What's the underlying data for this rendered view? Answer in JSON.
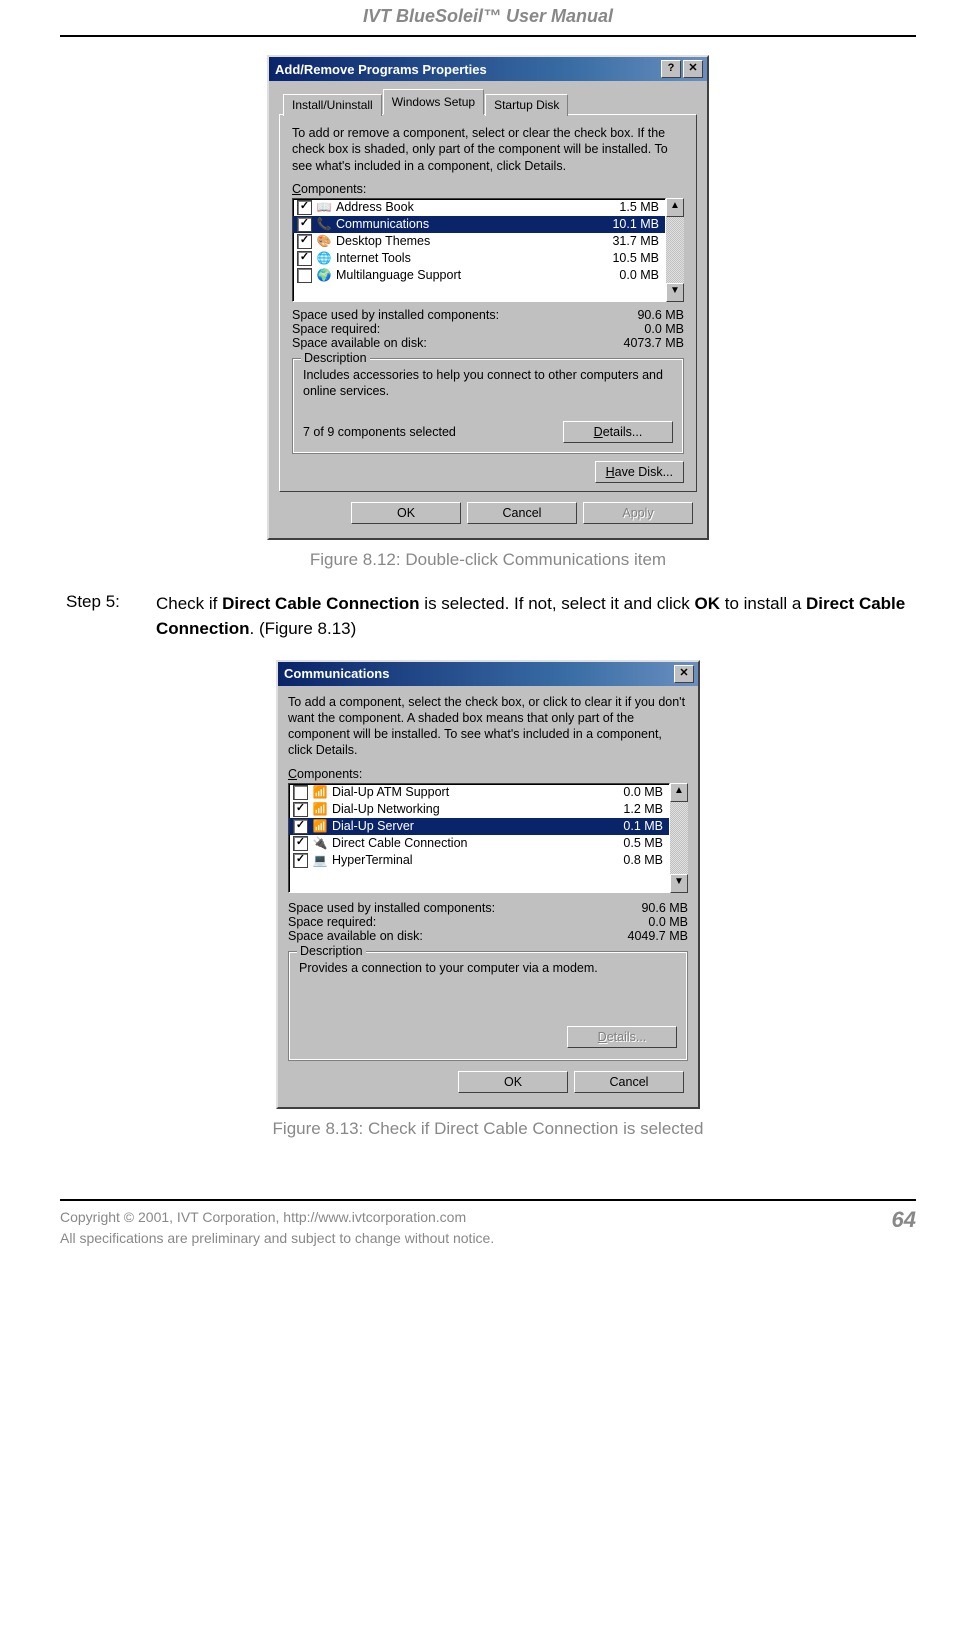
{
  "doc": {
    "header_title": "IVT BlueSoleil™ User Manual",
    "footer_line1": "Copyright © 2001, IVT Corporation, http://www.ivtcorporation.com",
    "footer_line2": "All specifications are preliminary and subject to change without notice.",
    "page_number": "64"
  },
  "step5": {
    "label": "Step 5:",
    "text_pre": "Check if ",
    "bold1": "Direct Cable Connection",
    "text_mid1": " is selected. If not, select it and click ",
    "bold2": "OK",
    "text_mid2": " to install a ",
    "bold3": "Direct Cable Connection",
    "text_post": ". (Figure 8.13)"
  },
  "fig812_caption": "Figure 8.12: Double-click Communications item",
  "fig813_caption": "Figure 8.13: Check if Direct Cable Connection is selected",
  "dlg1": {
    "title": "Add/Remove Programs Properties",
    "help_btn": "?",
    "close_btn": "✕",
    "tabs": {
      "t1": "Install/Uninstall",
      "t2": "Windows Setup",
      "t3": "Startup Disk"
    },
    "instr": "To add or remove a component, select or clear the check box. If the check box is shaded, only part of the component will be installed. To see what's included in a component, click Details.",
    "components_label": "Components:",
    "items": [
      {
        "checked": true,
        "icon": "📖",
        "name": "Address Book",
        "size": "1.5 MB"
      },
      {
        "checked": true,
        "icon": "📞",
        "name": "Communications",
        "size": "10.1 MB",
        "selected": true
      },
      {
        "checked": true,
        "icon": "🎨",
        "name": "Desktop Themes",
        "size": "31.7 MB"
      },
      {
        "checked": true,
        "icon": "🌐",
        "name": "Internet Tools",
        "size": "10.5 MB"
      },
      {
        "checked": false,
        "icon": "🌍",
        "name": "Multilanguage Support",
        "size": "0.0 MB"
      }
    ],
    "space_used_label": "Space used by installed components:",
    "space_used": "90.6 MB",
    "space_req_label": "Space required:",
    "space_req": "0.0 MB",
    "space_avail_label": "Space available on disk:",
    "space_avail": "4073.7 MB",
    "desc_legend": "Description",
    "desc_text": "Includes accessories to help you connect to other computers and online services.",
    "sel_text": "7 of 9 components selected",
    "details_btn": "Details...",
    "have_disk_btn": "Have Disk...",
    "ok_btn": "OK",
    "cancel_btn": "Cancel",
    "apply_btn": "Apply"
  },
  "dlg2": {
    "title": "Communications",
    "close_btn": "✕",
    "instr": "To add a component, select the check box, or click to clear it if you don't want the component. A shaded box means that only part of the component will be installed. To see what's included in a component, click Details.",
    "components_label": "Components:",
    "items": [
      {
        "checked": false,
        "icon": "📶",
        "name": "Dial-Up ATM Support",
        "size": "0.0 MB"
      },
      {
        "checked": true,
        "icon": "📶",
        "name": "Dial-Up Networking",
        "size": "1.2 MB"
      },
      {
        "checked": true,
        "icon": "📶",
        "name": "Dial-Up Server",
        "size": "0.1 MB",
        "selected": true
      },
      {
        "checked": true,
        "icon": "🔌",
        "name": "Direct Cable Connection",
        "size": "0.5 MB"
      },
      {
        "checked": true,
        "icon": "💻",
        "name": "HyperTerminal",
        "size": "0.8 MB"
      }
    ],
    "space_used_label": "Space used by installed components:",
    "space_used": "90.6 MB",
    "space_req_label": "Space required:",
    "space_req": "0.0 MB",
    "space_avail_label": "Space available on disk:",
    "space_avail": "4049.7 MB",
    "desc_legend": "Description",
    "desc_text": "Provides a connection to your computer via a modem.",
    "details_btn": "Details...",
    "ok_btn": "OK",
    "cancel_btn": "Cancel"
  }
}
